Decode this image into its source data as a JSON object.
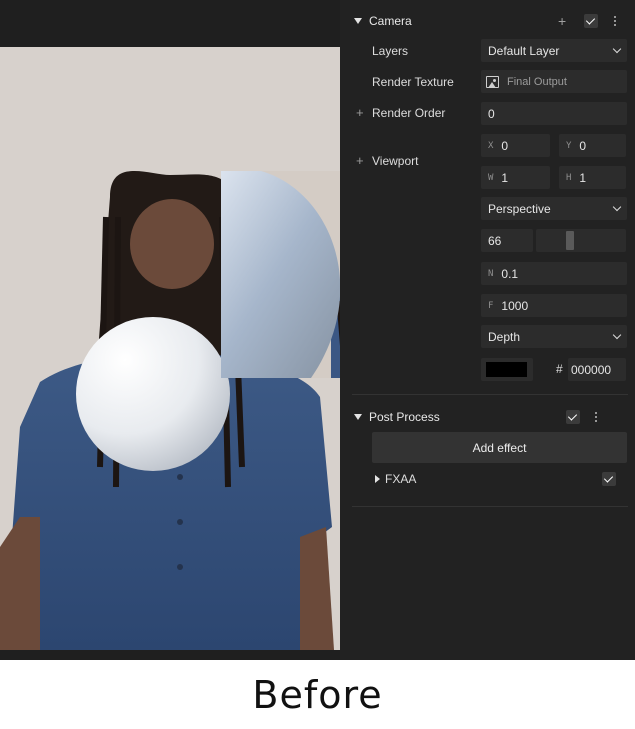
{
  "inspector": {
    "camera": {
      "title": "Camera",
      "layers_label": "Layers",
      "layers_value": "Default Layer",
      "render_texture_label": "Render Texture",
      "render_texture_value": "Final Output",
      "render_order_label": "Render Order",
      "render_order_value": "0",
      "viewport_label": "Viewport",
      "viewport_x_prefix": "X",
      "viewport_x": "0",
      "viewport_y_prefix": "Y",
      "viewport_y": "0",
      "viewport_w_prefix": "W",
      "viewport_w": "1",
      "viewport_h_prefix": "H",
      "viewport_h": "1",
      "projection_value": "Perspective",
      "fov_value": "66",
      "fov_slider_fraction": 0.37,
      "near_prefix": "N",
      "near_value": "0.1",
      "far_prefix": "F",
      "far_value": "1000",
      "clear_mode_value": "Depth",
      "clear_color_hash": "#",
      "clear_color_value": "000000",
      "clear_color_swatch": "#000000",
      "enabled": true
    },
    "post_process": {
      "title": "Post Process",
      "add_effect_label": "Add effect",
      "effects": [
        {
          "name": "FXAA",
          "enabled": true
        }
      ],
      "enabled": true
    }
  },
  "caption": "Before",
  "colors": {
    "panel_bg": "#222222",
    "field_bg": "#2c2c2c",
    "viewport_bg": "#d7d1cc"
  }
}
